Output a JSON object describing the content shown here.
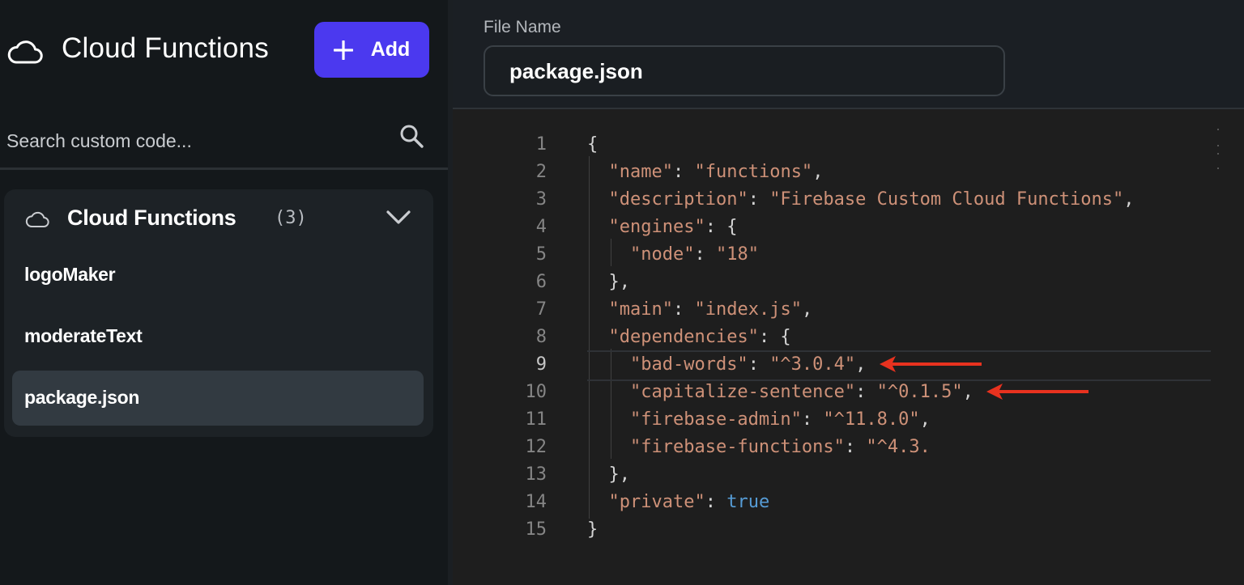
{
  "sidebar": {
    "title": "Cloud Functions",
    "add_button": {
      "label": "Add"
    },
    "search": {
      "placeholder": "Search custom code..."
    },
    "group": {
      "title": "Cloud Functions",
      "count": "(3)",
      "items": [
        {
          "label": "logoMaker",
          "selected": false
        },
        {
          "label": "moderateText",
          "selected": false
        },
        {
          "label": "package.json",
          "selected": true
        }
      ]
    }
  },
  "editor": {
    "file_name_label": "File Name",
    "file_name_value": "package.json",
    "current_line": 9,
    "lines": [
      {
        "n": "1",
        "tokens": [
          [
            "p",
            "{"
          ]
        ]
      },
      {
        "n": "2",
        "tokens": [
          [
            "p",
            "  "
          ],
          [
            "k",
            "\"name\""
          ],
          [
            "p",
            ": "
          ],
          [
            "v",
            "\"functions\""
          ],
          [
            "p",
            ","
          ]
        ]
      },
      {
        "n": "3",
        "tokens": [
          [
            "p",
            "  "
          ],
          [
            "k",
            "\"description\""
          ],
          [
            "p",
            ": "
          ],
          [
            "v",
            "\"Firebase Custom Cloud Functions\""
          ],
          [
            "p",
            ","
          ]
        ]
      },
      {
        "n": "4",
        "tokens": [
          [
            "p",
            "  "
          ],
          [
            "k",
            "\"engines\""
          ],
          [
            "p",
            ": {"
          ]
        ]
      },
      {
        "n": "5",
        "tokens": [
          [
            "p",
            "    "
          ],
          [
            "k",
            "\"node\""
          ],
          [
            "p",
            ": "
          ],
          [
            "v",
            "\"18\""
          ]
        ]
      },
      {
        "n": "6",
        "tokens": [
          [
            "p",
            "  },"
          ]
        ]
      },
      {
        "n": "7",
        "tokens": [
          [
            "p",
            "  "
          ],
          [
            "k",
            "\"main\""
          ],
          [
            "p",
            ": "
          ],
          [
            "v",
            "\"index.js\""
          ],
          [
            "p",
            ","
          ]
        ]
      },
      {
        "n": "8",
        "tokens": [
          [
            "p",
            "  "
          ],
          [
            "k",
            "\"dependencies\""
          ],
          [
            "p",
            ": {"
          ]
        ]
      },
      {
        "n": "9",
        "tokens": [
          [
            "p",
            "    "
          ],
          [
            "k",
            "\"bad-words\""
          ],
          [
            "p",
            ": "
          ],
          [
            "v",
            "\"^3.0.4\""
          ],
          [
            "p",
            ","
          ]
        ]
      },
      {
        "n": "10",
        "tokens": [
          [
            "p",
            "    "
          ],
          [
            "k",
            "\"capitalize-sentence\""
          ],
          [
            "p",
            ": "
          ],
          [
            "v",
            "\"^0.1.5\""
          ],
          [
            "p",
            ","
          ]
        ]
      },
      {
        "n": "11",
        "tokens": [
          [
            "p",
            "    "
          ],
          [
            "k",
            "\"firebase-admin\""
          ],
          [
            "p",
            ": "
          ],
          [
            "v",
            "\"^11.8.0\""
          ],
          [
            "p",
            ","
          ]
        ]
      },
      {
        "n": "12",
        "tokens": [
          [
            "p",
            "    "
          ],
          [
            "k",
            "\"firebase-functions\""
          ],
          [
            "p",
            ": "
          ],
          [
            "v",
            "\"^4.3."
          ]
        ]
      },
      {
        "n": "13",
        "tokens": [
          [
            "p",
            "  },"
          ]
        ]
      },
      {
        "n": "14",
        "tokens": [
          [
            "p",
            "  "
          ],
          [
            "k",
            "\"private\""
          ],
          [
            "p",
            ": "
          ],
          [
            "kw",
            "true"
          ]
        ]
      },
      {
        "n": "15",
        "tokens": [
          [
            "p",
            "}"
          ]
        ]
      }
    ]
  },
  "annotations": {
    "arrow_color": "#e8321f",
    "arrow_lines": [
      9,
      10
    ]
  },
  "colors": {
    "accent": "#4b39ef",
    "string": "#ce9178",
    "keyword": "#569cd6",
    "background": "#14181b",
    "editor_background": "#1e1e1e"
  },
  "icons": {
    "header": "cloud-icon",
    "add": "plus-icon",
    "search": "search-icon",
    "group": "cloud-icon",
    "collapse": "chevron-down-icon"
  }
}
